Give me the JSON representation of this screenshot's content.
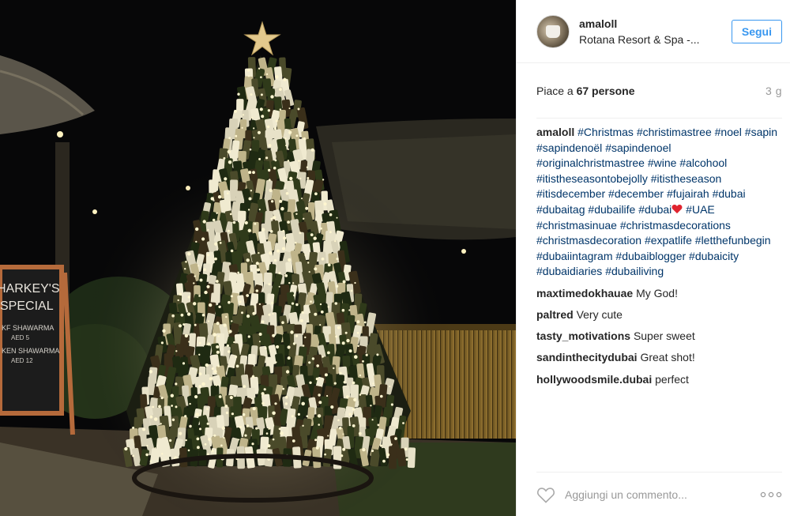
{
  "post": {
    "image_alt": "Christmas tree made of wine bottles"
  },
  "header": {
    "username": "amaloll",
    "location": "Rotana Resort & Spa -...",
    "follow_label": "Segui"
  },
  "likes": {
    "prefix": "Piace a ",
    "count": "67 persone",
    "time": "3 g"
  },
  "caption": {
    "user": "amaloll",
    "tags_before_heart": [
      "#Christmas",
      "#christimastree",
      "#noel",
      "#sapin",
      "#sapindenoël",
      "#sapindenoel",
      "#originalchristmastree",
      "#wine",
      "#alcohool",
      "#itistheseasontobejolly",
      "#itistheseason",
      "#itisdecember",
      "#december",
      "#fujairah",
      "#dubai",
      "#dubaitag",
      "#dubailife",
      "#dubai"
    ],
    "tags_after_heart": [
      "#UAE",
      "#christmasinuae",
      "#christmasdecorations",
      "#christmasdecoration",
      "#expatlife",
      "#letthefunbegin",
      "#dubaiintagram",
      "#dubaiblogger",
      "#dubaicity",
      "#dubaidiaries",
      "#dubailiving"
    ]
  },
  "comments": [
    {
      "user": "maxtimedokhauae",
      "text": "My God!"
    },
    {
      "user": "paltred",
      "text": "Very cute"
    },
    {
      "user": "tasty_motivations",
      "text": "Super sweet"
    },
    {
      "user": "sandinthecitydubai",
      "text": "Great shot!"
    },
    {
      "user": "hollywoodsmile.dubai",
      "text": "perfect"
    }
  ],
  "footer": {
    "comment_placeholder": "Aggiungi un commento...",
    "heart_icon": "heart-outline-icon",
    "more_icon": "more-options-icon"
  },
  "sign": {
    "line1": "HARKEY'S",
    "line2": "SPECIAL",
    "line3": "KF SHAWARMA",
    "line4": "AED 5",
    "line5": "KEN SHAWARMA",
    "line6": "AED 12"
  },
  "colors": {
    "accent": "#3897f0",
    "hashtag": "#003569",
    "muted": "#999999"
  }
}
